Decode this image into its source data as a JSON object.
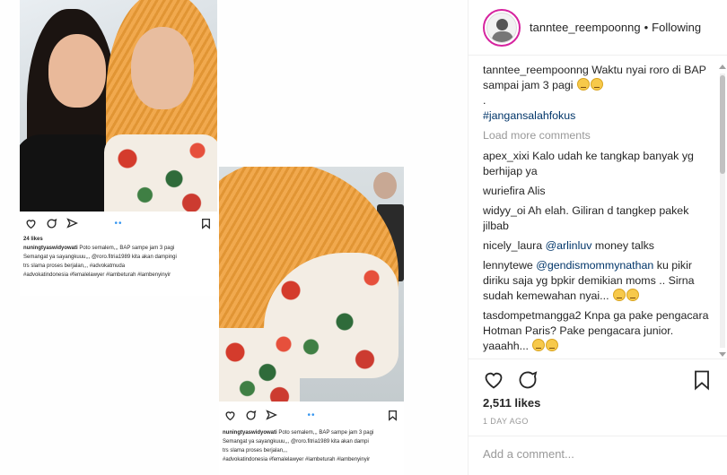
{
  "post": {
    "username": "tanntee_reempoonng",
    "separator": "•",
    "follow_label": "Following",
    "caption": {
      "username": "tanntee_reempoonng",
      "text": "Waktu nyai roro di BAP sampai jam 3 pagi",
      "line2": ".",
      "hashtag": "#jangansalahfokus"
    },
    "load_more": "Load more comments",
    "comments": [
      {
        "user": "apex_xixi",
        "text": "Kalo udah ke tangkap banyak yg berhijap ya"
      },
      {
        "user": "wuriefira",
        "text": "Alis"
      },
      {
        "user": "widyy_oi",
        "text": "Ah elah. Giliran d tangkep pakek jilbab"
      },
      {
        "user": "nicely_laura",
        "mention": "@arlinluv",
        "text": "money talks"
      },
      {
        "user": "lennytewe",
        "mention": "@gendismommynathan",
        "text": "ku pikir diriku saja yg bpkir demikian moms .. Sirna sudah kemewahan nyai..."
      },
      {
        "user": "tasdompetmangga2",
        "text": "Knpa ga pake pengacara Hotman Paris? Pake pengacara junior. yaaahh..."
      }
    ],
    "likes": "2,511 likes",
    "time": "1 DAY AGO",
    "add_comment_placeholder": "Add a comment..."
  },
  "screenshot1": {
    "likes": "24 likes",
    "username": "nuningtyaswidyowati",
    "caption": "Poto semalem,,, BAP sampe jam 3 pagi",
    "line2": "Semangat ya sayangkuuu,,, @roro.fitria1989 kita akan dampingi",
    "line3": "trs slama proses berjalan,,,",
    "mention_tag": "#advokatmuda",
    "line4": "#advokatindonesia #femalelawyer #lambeturah #lambenyinyir"
  },
  "screenshot2": {
    "username": "nuningtyaswidyowati",
    "caption": "Poto semalem,,, BAP sampe jam 3 pagi",
    "line2": "Semangat ya sayangkuuu,,, @roro.fitria1989 kita akan dampi",
    "line3": "trs slama proses berjalan,,,",
    "line4": "#advokatindonesia #femalelawyer #lambeturah #lambenyinyir"
  },
  "colors": {
    "link": "#003569",
    "muted": "#999999",
    "text": "#262626",
    "story_ring": "#d6249f"
  }
}
